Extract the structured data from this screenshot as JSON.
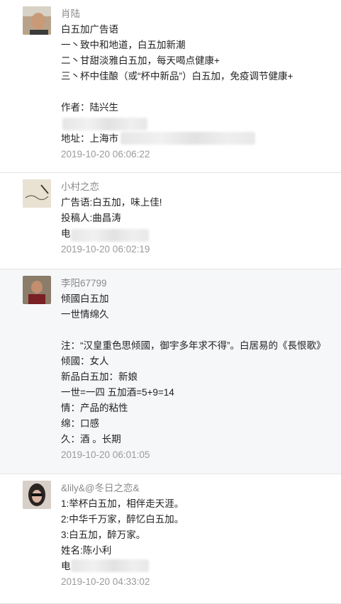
{
  "comments": [
    {
      "author": "肖陆",
      "lines": [
        "白五加广告语",
        "一丶致中和地道，白五加新潮",
        "二丶甘甜淡雅白五加，每天喝点健康+",
        "三丶杯中佳酿（或“杯中新品”）白五加，免疫调节健康+",
        "",
        "作者：陆兴生",
        "",
        "地址：上海市"
      ],
      "timestamp": "2019-10-20 06:06:22"
    },
    {
      "author": "小村之恋",
      "lines": [
        "广告语:白五加，味上佳!",
        "投稿人:曲昌涛",
        "电"
      ],
      "timestamp": "2019-10-20 06:02:19"
    },
    {
      "author": "李阳67799",
      "lines": [
        "倾國白五加",
        "一世情绵久",
        "",
        "注：“汉皇重色思倾國，御宇多年求不得”。白居易的《長恨歌》",
        "倾國：女人",
        "新品白五加：新娘",
        "一世=一四 五加酒=5+9=14",
        "情：产品的粘性",
        "绵：口感",
        "久：酒 。长期"
      ],
      "timestamp": "2019-10-20 06:01:05"
    },
    {
      "author": "&lily&@冬日之恋&",
      "lines": [
        "1:举杯白五加，相伴走天涯。",
        "2:中华千万家，醉忆白五加。",
        "3:白五加，醉万家。",
        "姓名:陈小利",
        "电"
      ],
      "timestamp": "2019-10-20 04:33:02"
    }
  ]
}
